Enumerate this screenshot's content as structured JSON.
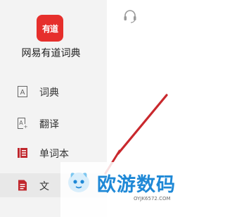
{
  "app": {
    "logo_text": "有道",
    "name": "网易有道词典",
    "brand_color": "#e62f2c"
  },
  "sidebar": {
    "items": [
      {
        "label": "词典",
        "icon": "dictionary-icon"
      },
      {
        "label": "翻译",
        "icon": "translate-icon"
      },
      {
        "label": "单词本",
        "icon": "wordbook-icon"
      },
      {
        "label": "文",
        "icon": "document-icon",
        "active": true
      }
    ]
  },
  "main": {
    "icon": "headset-icon"
  },
  "watermark": {
    "text": "欧游数码",
    "url": "OYJK6572.COM",
    "color": "#1e88d6"
  }
}
